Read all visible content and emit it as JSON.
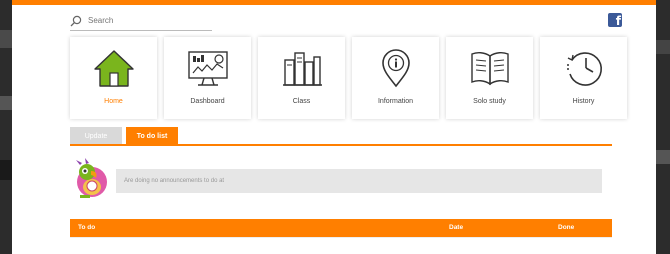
{
  "search": {
    "placeholder": "Search"
  },
  "header": {
    "facebook_icon": "facebook-icon",
    "brand_color": "#ff7f00"
  },
  "nav_tiles": [
    {
      "label": "Home",
      "icon": "home-icon",
      "active": true
    },
    {
      "label": "Dashboard",
      "icon": "dashboard-icon",
      "active": false
    },
    {
      "label": "Class",
      "icon": "class-icon",
      "active": false
    },
    {
      "label": "Information",
      "icon": "info-pin-icon",
      "active": false
    },
    {
      "label": "Solo study",
      "icon": "book-icon",
      "active": false
    },
    {
      "label": "History",
      "icon": "history-icon",
      "active": false
    }
  ],
  "tabs": [
    {
      "label": "Update",
      "active": false
    },
    {
      "label": "To do list",
      "active": true
    }
  ],
  "task_message": "Are doing no announcements to do at",
  "table": {
    "columns": [
      "To do",
      "Date",
      "Done"
    ]
  }
}
